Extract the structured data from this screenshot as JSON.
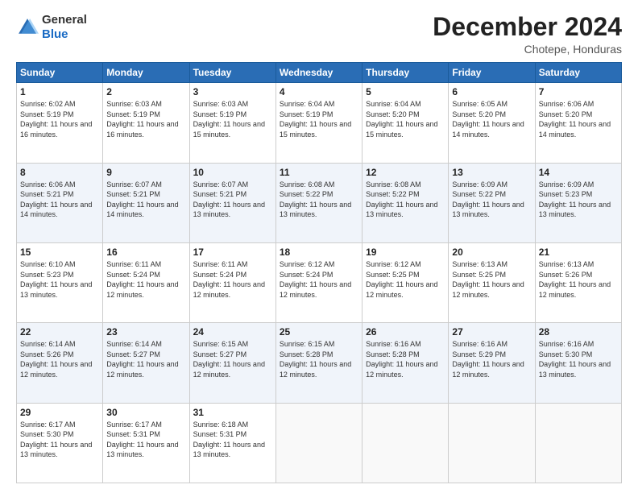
{
  "logo": {
    "general": "General",
    "blue": "Blue"
  },
  "header": {
    "month": "December 2024",
    "location": "Chotepe, Honduras"
  },
  "days_of_week": [
    "Sunday",
    "Monday",
    "Tuesday",
    "Wednesday",
    "Thursday",
    "Friday",
    "Saturday"
  ],
  "weeks": [
    [
      {
        "day": "1",
        "sunrise": "6:02 AM",
        "sunset": "5:19 PM",
        "daylight": "11 hours and 16 minutes."
      },
      {
        "day": "2",
        "sunrise": "6:03 AM",
        "sunset": "5:19 PM",
        "daylight": "11 hours and 16 minutes."
      },
      {
        "day": "3",
        "sunrise": "6:03 AM",
        "sunset": "5:19 PM",
        "daylight": "11 hours and 15 minutes."
      },
      {
        "day": "4",
        "sunrise": "6:04 AM",
        "sunset": "5:19 PM",
        "daylight": "11 hours and 15 minutes."
      },
      {
        "day": "5",
        "sunrise": "6:04 AM",
        "sunset": "5:20 PM",
        "daylight": "11 hours and 15 minutes."
      },
      {
        "day": "6",
        "sunrise": "6:05 AM",
        "sunset": "5:20 PM",
        "daylight": "11 hours and 14 minutes."
      },
      {
        "day": "7",
        "sunrise": "6:06 AM",
        "sunset": "5:20 PM",
        "daylight": "11 hours and 14 minutes."
      }
    ],
    [
      {
        "day": "8",
        "sunrise": "6:06 AM",
        "sunset": "5:21 PM",
        "daylight": "11 hours and 14 minutes."
      },
      {
        "day": "9",
        "sunrise": "6:07 AM",
        "sunset": "5:21 PM",
        "daylight": "11 hours and 14 minutes."
      },
      {
        "day": "10",
        "sunrise": "6:07 AM",
        "sunset": "5:21 PM",
        "daylight": "11 hours and 13 minutes."
      },
      {
        "day": "11",
        "sunrise": "6:08 AM",
        "sunset": "5:22 PM",
        "daylight": "11 hours and 13 minutes."
      },
      {
        "day": "12",
        "sunrise": "6:08 AM",
        "sunset": "5:22 PM",
        "daylight": "11 hours and 13 minutes."
      },
      {
        "day": "13",
        "sunrise": "6:09 AM",
        "sunset": "5:22 PM",
        "daylight": "11 hours and 13 minutes."
      },
      {
        "day": "14",
        "sunrise": "6:09 AM",
        "sunset": "5:23 PM",
        "daylight": "11 hours and 13 minutes."
      }
    ],
    [
      {
        "day": "15",
        "sunrise": "6:10 AM",
        "sunset": "5:23 PM",
        "daylight": "11 hours and 13 minutes."
      },
      {
        "day": "16",
        "sunrise": "6:11 AM",
        "sunset": "5:24 PM",
        "daylight": "11 hours and 12 minutes."
      },
      {
        "day": "17",
        "sunrise": "6:11 AM",
        "sunset": "5:24 PM",
        "daylight": "11 hours and 12 minutes."
      },
      {
        "day": "18",
        "sunrise": "6:12 AM",
        "sunset": "5:24 PM",
        "daylight": "11 hours and 12 minutes."
      },
      {
        "day": "19",
        "sunrise": "6:12 AM",
        "sunset": "5:25 PM",
        "daylight": "11 hours and 12 minutes."
      },
      {
        "day": "20",
        "sunrise": "6:13 AM",
        "sunset": "5:25 PM",
        "daylight": "11 hours and 12 minutes."
      },
      {
        "day": "21",
        "sunrise": "6:13 AM",
        "sunset": "5:26 PM",
        "daylight": "11 hours and 12 minutes."
      }
    ],
    [
      {
        "day": "22",
        "sunrise": "6:14 AM",
        "sunset": "5:26 PM",
        "daylight": "11 hours and 12 minutes."
      },
      {
        "day": "23",
        "sunrise": "6:14 AM",
        "sunset": "5:27 PM",
        "daylight": "11 hours and 12 minutes."
      },
      {
        "day": "24",
        "sunrise": "6:15 AM",
        "sunset": "5:27 PM",
        "daylight": "11 hours and 12 minutes."
      },
      {
        "day": "25",
        "sunrise": "6:15 AM",
        "sunset": "5:28 PM",
        "daylight": "11 hours and 12 minutes."
      },
      {
        "day": "26",
        "sunrise": "6:16 AM",
        "sunset": "5:28 PM",
        "daylight": "11 hours and 12 minutes."
      },
      {
        "day": "27",
        "sunrise": "6:16 AM",
        "sunset": "5:29 PM",
        "daylight": "11 hours and 12 minutes."
      },
      {
        "day": "28",
        "sunrise": "6:16 AM",
        "sunset": "5:30 PM",
        "daylight": "11 hours and 13 minutes."
      }
    ],
    [
      {
        "day": "29",
        "sunrise": "6:17 AM",
        "sunset": "5:30 PM",
        "daylight": "11 hours and 13 minutes."
      },
      {
        "day": "30",
        "sunrise": "6:17 AM",
        "sunset": "5:31 PM",
        "daylight": "11 hours and 13 minutes."
      },
      {
        "day": "31",
        "sunrise": "6:18 AM",
        "sunset": "5:31 PM",
        "daylight": "11 hours and 13 minutes."
      },
      null,
      null,
      null,
      null
    ]
  ],
  "labels": {
    "sunrise": "Sunrise:",
    "sunset": "Sunset:",
    "daylight": "Daylight:"
  }
}
